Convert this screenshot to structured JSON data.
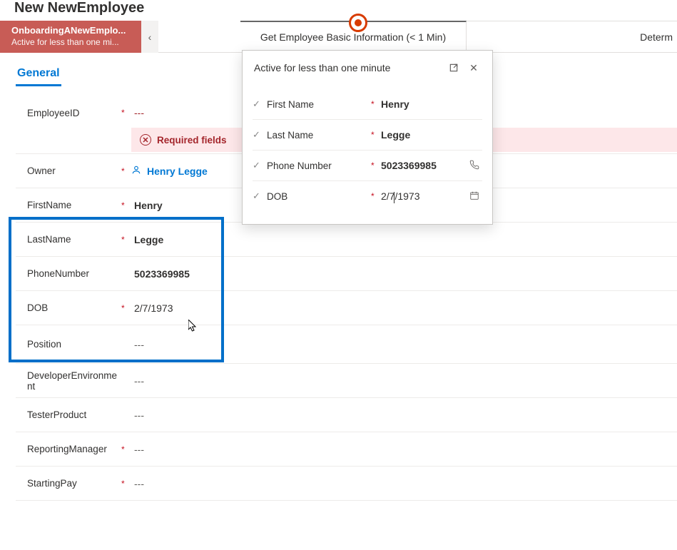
{
  "page_title": "New NewEmployee",
  "bpf": {
    "active_stage_name": "OnboardingANewEmplo...",
    "active_stage_sub": "Active for less than one mi...",
    "collapse_glyph": "‹",
    "stage2": "Get Employee Basic Information  (< 1 Min)",
    "stage3": "Determ"
  },
  "tab_general": "General",
  "error_glyph": "✕",
  "error_text": "Required fields",
  "empty_placeholder": "---",
  "fields": {
    "employee_id_label": "EmployeeID",
    "owner_label": "Owner",
    "owner_value": "Henry Legge",
    "first_name_label": "FirstName",
    "first_name_value": "Henry",
    "last_name_label": "LastName",
    "last_name_value": "Legge",
    "phone_label": "PhoneNumber",
    "phone_value": "5023369985",
    "dob_label": "DOB",
    "dob_value": "2/7/1973",
    "position_label": "Position",
    "dev_env_label": "DeveloperEnvironment",
    "tester_label": "TesterProduct",
    "manager_label": "ReportingManager",
    "pay_label": "StartingPay"
  },
  "popup": {
    "title": "Active for less than one minute",
    "popout_glyph": "⇱",
    "close_glyph": "✕",
    "check_glyph": "✓",
    "phone_glyph": "✆",
    "cal_glyph": "📅",
    "first_name_label": "First Name",
    "first_name_value": "Henry",
    "last_name_label": "Last Name",
    "last_name_value": "Legge",
    "phone_label": "Phone Number",
    "phone_value": "5023369985",
    "dob_label": "DOB",
    "dob_value": "2/7/1973"
  }
}
